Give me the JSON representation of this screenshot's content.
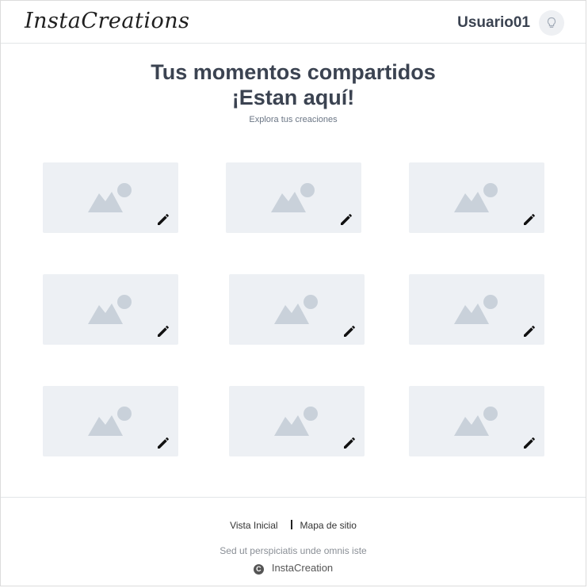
{
  "header": {
    "logo": "InstaCreations",
    "user_name": "Usuario01",
    "theme_icon": "lightbulb-icon"
  },
  "hero": {
    "title_line1": "Tus momentos compartidos",
    "title_line2": "¡Estan aquí!",
    "subtitle": "Explora tus creaciones"
  },
  "gallery": {
    "item_count": 9,
    "placeholder_icon": "image-placeholder-icon",
    "edit_icon": "pencil-icon"
  },
  "footer": {
    "link_home": "Vista Inicial",
    "link_sitemap": "Mapa de sitio",
    "tagline": "Sed ut perspiciatis unde omnis iste",
    "copyright": "InstaCreation",
    "copyright_symbol": "C"
  },
  "colors": {
    "text_dark": "#3b4351",
    "tile_bg": "#edf0f4",
    "placeholder": "#c9d1da"
  }
}
